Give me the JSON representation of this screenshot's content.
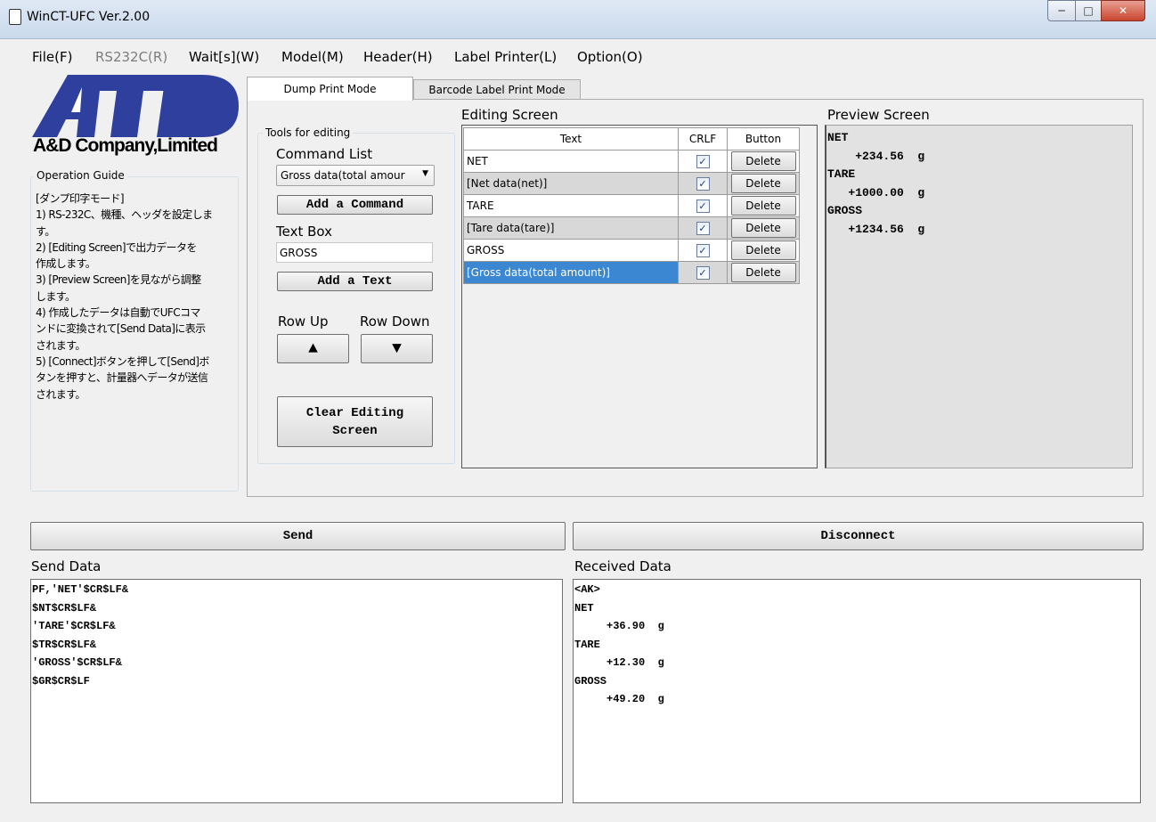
{
  "window": {
    "title": "WinCT-UFC  Ver.2.00"
  },
  "menu": [
    "File(F)",
    "RS232C(R)",
    "Wait[s](W)",
    "Model(M)",
    "Header(H)",
    "Label Printer(L)",
    "Option(O)"
  ],
  "logo": {
    "mark": "A&D",
    "company": "A&D Company,Limited"
  },
  "guide": {
    "label": "Operation Guide",
    "text": "[ダンプ印字モード]\n1) RS-232C、機種、ヘッダを設定しま\nす。\n2) [Editing Screen]で出力データを\n作成します。\n3) [Preview Screen]を見ながら調整\nします。\n4) 作成したデータは自動でUFCコマ\nンドに変換されて[Send Data]に表示\nされます。\n5) [Connect]ボタンを押して[Send]ボ\nタンを押すと、計量器へデータが送信\nされます。"
  },
  "tabs": {
    "dump": "Dump Print Mode",
    "barcode": "Barcode Label Print Mode"
  },
  "tools": {
    "label": "Tools for editing",
    "command_list_label": "Command List",
    "command_selected": "Gross data(total amour",
    "add_command": "Add a Command",
    "text_box_label": "Text Box",
    "text_box_value": "GROSS",
    "add_text": "Add a Text",
    "row_up_label": "Row Up",
    "row_down_label": "Row Down",
    "clear_line1": "Clear Editing",
    "clear_line2": "Screen"
  },
  "editing": {
    "label": "Editing Screen",
    "headers": {
      "text": "Text",
      "crlf": "CRLF",
      "button": "Button"
    },
    "rows": [
      {
        "text": "NET",
        "delete": "Delete"
      },
      {
        "text": "[Net data(net)]",
        "delete": "Delete"
      },
      {
        "text": "TARE",
        "delete": "Delete"
      },
      {
        "text": "[Tare data(tare)]",
        "delete": "Delete"
      },
      {
        "text": "GROSS",
        "delete": "Delete"
      },
      {
        "text": "[Gross data(total amount)]",
        "delete": "Delete"
      }
    ]
  },
  "preview": {
    "label": "Preview Screen",
    "text": "NET\n    +234.56  g\nTARE\n   +1000.00  g\nGROSS\n   +1234.56  g"
  },
  "buttons": {
    "send": "Send",
    "disconnect": "Disconnect"
  },
  "send_data": {
    "label": "Send Data",
    "text": "PF,'NET'$CR$LF&\n$NT$CR$LF&\n'TARE'$CR$LF&\n$TR$CR$LF&\n'GROSS'$CR$LF&\n$GR$CR$LF"
  },
  "received_data": {
    "label": "Received Data",
    "text": "<AK>\nNET\n     +36.90  g\nTARE\n     +12.30  g\nGROSS\n     +49.20  g"
  }
}
